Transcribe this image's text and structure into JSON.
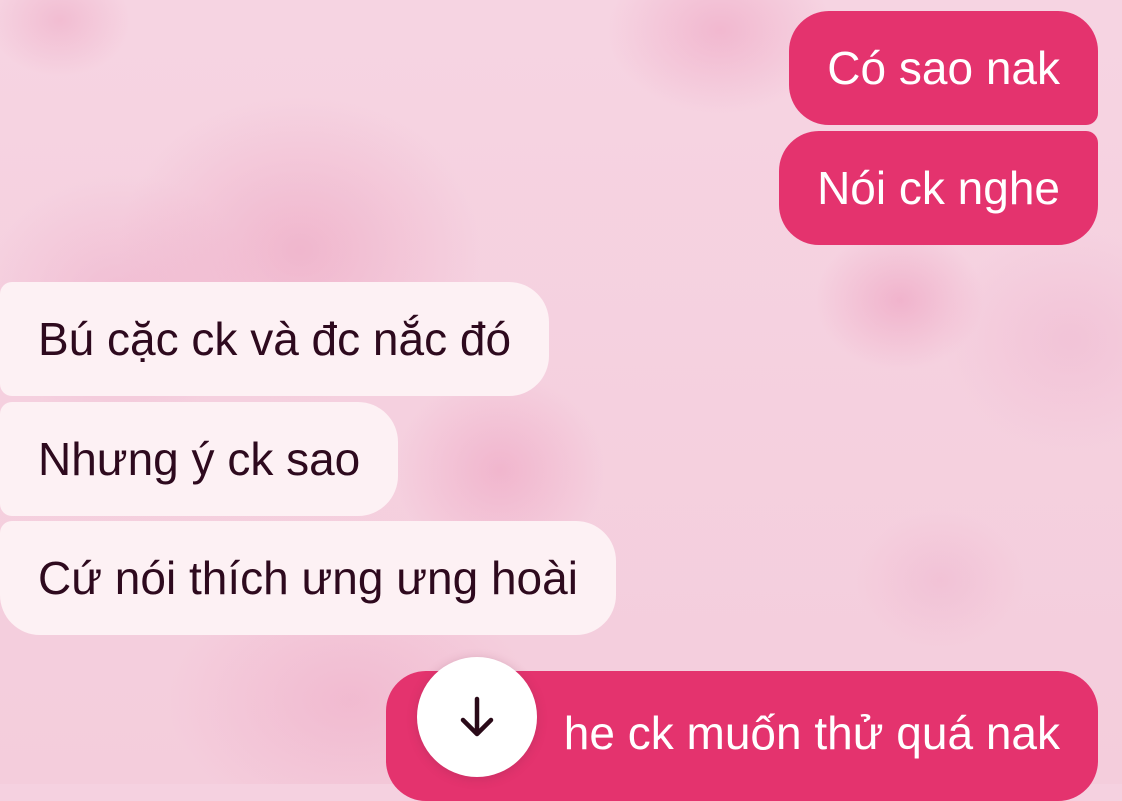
{
  "messages": [
    {
      "direction": "outgoing",
      "text": "Có sao nak"
    },
    {
      "direction": "outgoing",
      "text": "Nói ck nghe"
    },
    {
      "direction": "incoming",
      "text": "Bú cặc ck và đc nắc đó"
    },
    {
      "direction": "incoming",
      "text": "Nhưng ý ck sao"
    },
    {
      "direction": "incoming",
      "text": "Cứ nói thích ưng ưng hoài"
    },
    {
      "direction": "outgoing",
      "text": "he ck muốn thử quá nak"
    }
  ],
  "scroll_button": {
    "icon": "arrow-down-icon"
  },
  "colors": {
    "outgoing_bubble": "#e4336e",
    "incoming_bubble": "#fdf1f4",
    "background": "#f5d1e0"
  }
}
